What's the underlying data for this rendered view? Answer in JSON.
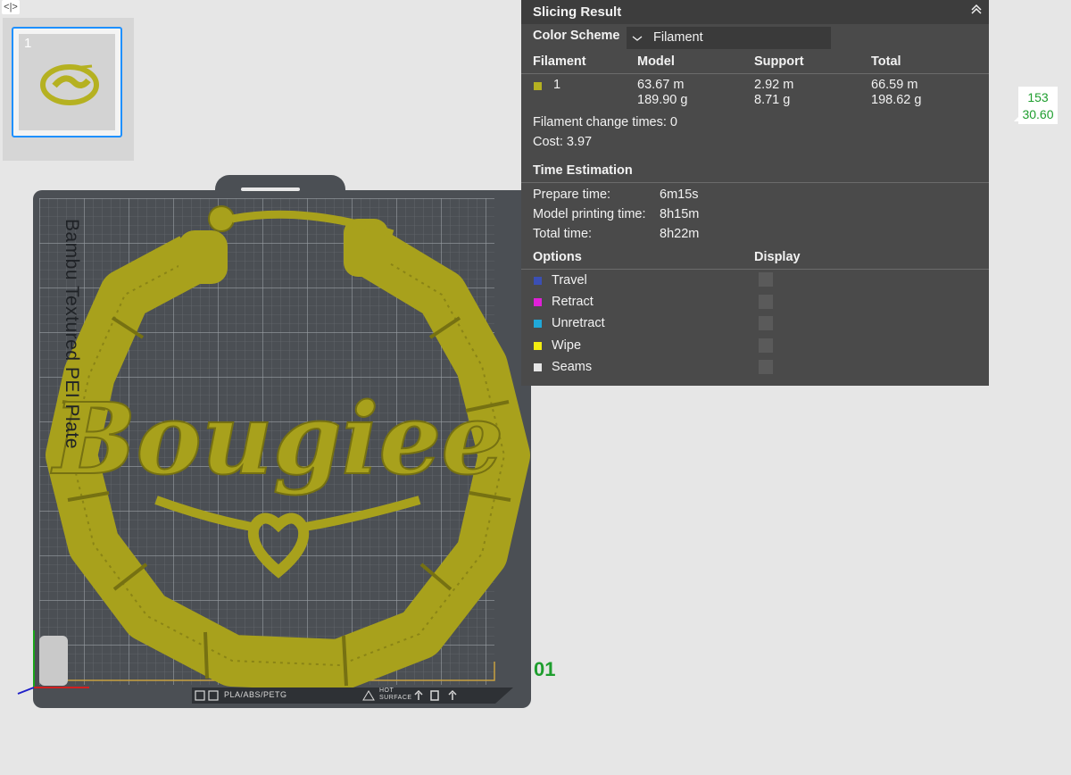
{
  "toolbar": {
    "toggle_label": "<|>"
  },
  "plates": {
    "thumbnail_number": "1"
  },
  "plate": {
    "name": "Bambu Textured PEI Plate",
    "filament_types": "PLA/ABS/PETG",
    "surface_note_line1": "HOT",
    "surface_note_line2": "SURFACE",
    "plate_number": "01",
    "model_text": "Bougiee"
  },
  "slicing_result": {
    "title": "Slicing Result",
    "color_scheme_label": "Color Scheme",
    "color_scheme_value": "Filament",
    "filament_table": {
      "headers": [
        "Filament",
        "Model",
        "Support",
        "Total"
      ],
      "rows": [
        {
          "id": "1",
          "color": "#b5b121",
          "model_length": "63.67 m",
          "model_weight": "189.90 g",
          "support_length": "2.92 m",
          "support_weight": "8.71 g",
          "total_length": "66.59 m",
          "total_weight": "198.62 g"
        }
      ]
    },
    "filament_change_times": "Filament change times:  0",
    "cost": "Cost:  3.97",
    "time_estimation": {
      "title": "Time Estimation",
      "prepare_label": "Prepare time:",
      "prepare_value": "6m15s",
      "model_label": "Model printing time:",
      "model_value": "8h15m",
      "total_label": "Total time:",
      "total_value": "8h22m"
    },
    "options": {
      "title": "Options",
      "display_title": "Display",
      "items": [
        {
          "label": "Travel",
          "color": "#3b4fb4"
        },
        {
          "label": "Retract",
          "color": "#e020d8"
        },
        {
          "label": "Unretract",
          "color": "#20a8d8"
        },
        {
          "label": "Wipe",
          "color": "#f2ec10"
        },
        {
          "label": "Seams",
          "color": "#e6e6e6"
        }
      ]
    }
  },
  "layer_tag": {
    "top": "153",
    "bottom": "30.60"
  },
  "colors": {
    "filament": "#b5b121",
    "accent": "#1e90ff",
    "green": "#1e9e2e"
  }
}
